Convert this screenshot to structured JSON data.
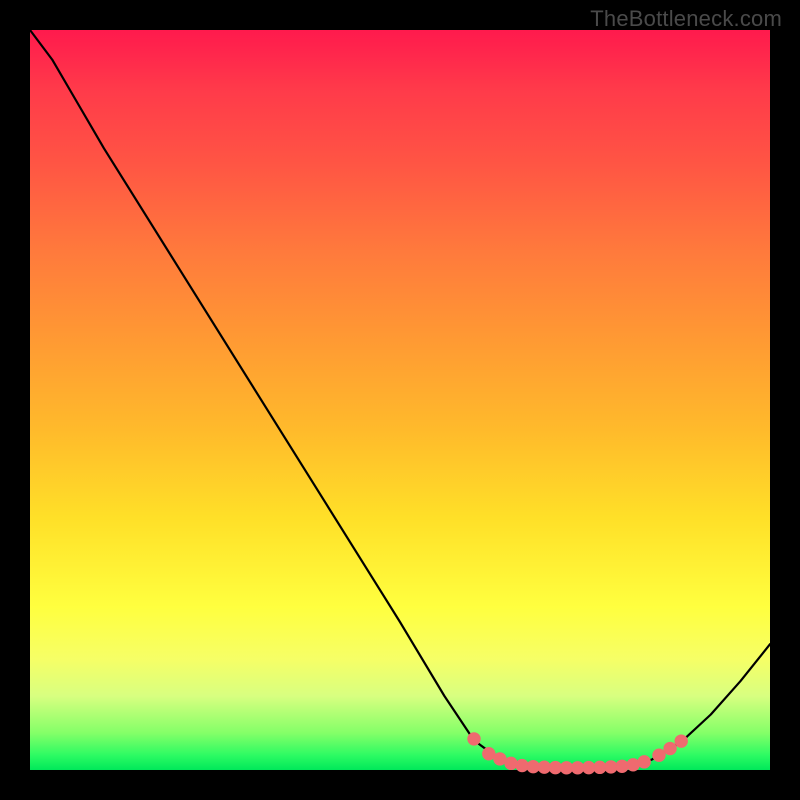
{
  "watermark": "TheBottleneck.com",
  "colors": {
    "curve_stroke": "#000000",
    "marker_fill": "#ef6a6f",
    "marker_stroke": "#ef6a6f"
  },
  "chart_data": {
    "type": "line",
    "title": "",
    "xlabel": "",
    "ylabel": "",
    "xlim": [
      0,
      100
    ],
    "ylim": [
      0,
      100
    ],
    "curve_points": [
      {
        "x": 0.0,
        "y": 100.0
      },
      {
        "x": 3.0,
        "y": 96.0
      },
      {
        "x": 6.5,
        "y": 90.0
      },
      {
        "x": 10.0,
        "y": 84.0
      },
      {
        "x": 20.0,
        "y": 68.0
      },
      {
        "x": 30.0,
        "y": 52.0
      },
      {
        "x": 40.0,
        "y": 36.0
      },
      {
        "x": 50.0,
        "y": 20.0
      },
      {
        "x": 56.0,
        "y": 10.0
      },
      {
        "x": 60.0,
        "y": 4.0
      },
      {
        "x": 63.0,
        "y": 1.8
      },
      {
        "x": 66.0,
        "y": 0.7
      },
      {
        "x": 70.0,
        "y": 0.3
      },
      {
        "x": 75.0,
        "y": 0.3
      },
      {
        "x": 80.0,
        "y": 0.5
      },
      {
        "x": 84.0,
        "y": 1.4
      },
      {
        "x": 88.0,
        "y": 3.8
      },
      {
        "x": 92.0,
        "y": 7.5
      },
      {
        "x": 96.0,
        "y": 12.0
      },
      {
        "x": 100.0,
        "y": 17.0
      }
    ],
    "markers": [
      {
        "x": 60.0,
        "y": 4.2
      },
      {
        "x": 62.0,
        "y": 2.2
      },
      {
        "x": 63.5,
        "y": 1.5
      },
      {
        "x": 65.0,
        "y": 0.9
      },
      {
        "x": 66.5,
        "y": 0.6
      },
      {
        "x": 68.0,
        "y": 0.45
      },
      {
        "x": 69.5,
        "y": 0.38
      },
      {
        "x": 71.0,
        "y": 0.32
      },
      {
        "x": 72.5,
        "y": 0.3
      },
      {
        "x": 74.0,
        "y": 0.3
      },
      {
        "x": 75.5,
        "y": 0.32
      },
      {
        "x": 77.0,
        "y": 0.36
      },
      {
        "x": 78.5,
        "y": 0.42
      },
      {
        "x": 80.0,
        "y": 0.5
      },
      {
        "x": 81.5,
        "y": 0.7
      },
      {
        "x": 83.0,
        "y": 1.1
      },
      {
        "x": 85.0,
        "y": 2.0
      },
      {
        "x": 86.5,
        "y": 2.9
      },
      {
        "x": 88.0,
        "y": 3.9
      }
    ]
  }
}
